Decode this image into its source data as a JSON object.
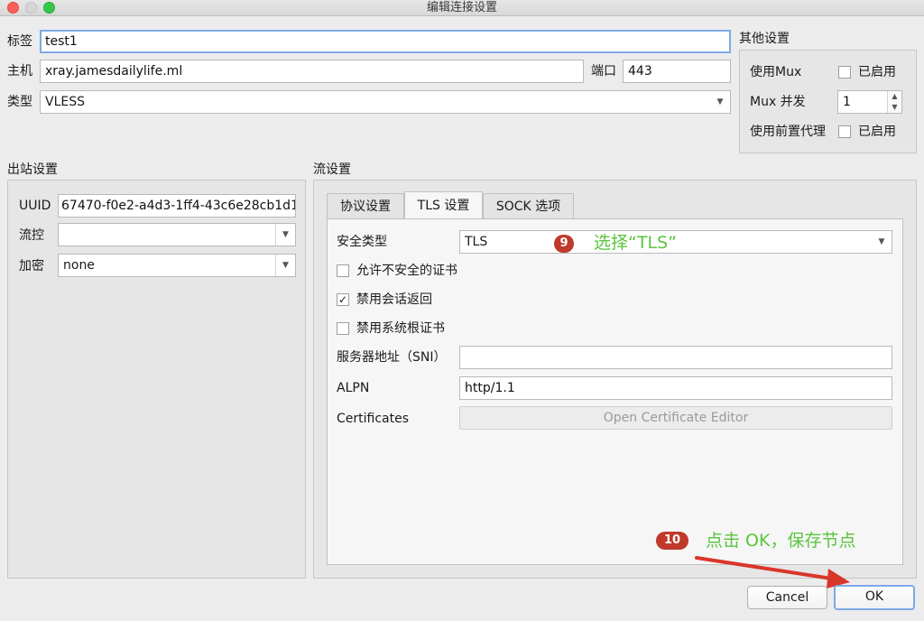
{
  "window": {
    "title": "编辑连接设置"
  },
  "form": {
    "tag_label": "标签",
    "tag_value": "test1",
    "host_label": "主机",
    "host_value": "xray.jamesdailylife.ml",
    "port_label": "端口",
    "port_value": "443",
    "type_label": "类型",
    "type_value": "VLESS"
  },
  "other": {
    "title": "其他设置",
    "mux_label": "使用Mux",
    "mux_check": "已启用",
    "mux_concurrency_label": "Mux 并发",
    "mux_concurrency_value": "1",
    "front_proxy_label": "使用前置代理",
    "front_proxy_check": "已启用"
  },
  "outbound": {
    "title": "出站设置",
    "uuid_label": "UUID",
    "uuid_value": "67470-f0e2-a4d3-1ff4-43c6e28cb1d1",
    "flow_label": "流控",
    "flow_value": "",
    "encryption_label": "加密",
    "encryption_value": "none"
  },
  "stream": {
    "title": "流设置",
    "tabs": [
      {
        "label": "协议设置"
      },
      {
        "label": "TLS 设置"
      },
      {
        "label": "SOCK 选项"
      }
    ],
    "security_type_label": "安全类型",
    "security_type_value": "TLS",
    "allow_insecure": "允许不安全的证书",
    "disable_session_resumption": "禁用会话返回",
    "disable_system_root": "禁用系统根证书",
    "sni_label": "服务器地址（SNI）",
    "sni_value": "",
    "alpn_label": "ALPN",
    "alpn_value": "http/1.1",
    "certificates_label": "Certificates",
    "cert_editor_button": "Open Certificate Editor"
  },
  "annotations": {
    "step9_number": "9",
    "step9_text": "选择“TLS”",
    "step10_number": "10",
    "step10_text": "点击 OK，保存节点"
  },
  "buttons": {
    "cancel": "Cancel",
    "ok": "OK"
  },
  "colors": {
    "accent": "#7ea9e6",
    "annotation_text": "#5ac43e",
    "badge": "#c0392b",
    "arrow": "#d9362a"
  }
}
